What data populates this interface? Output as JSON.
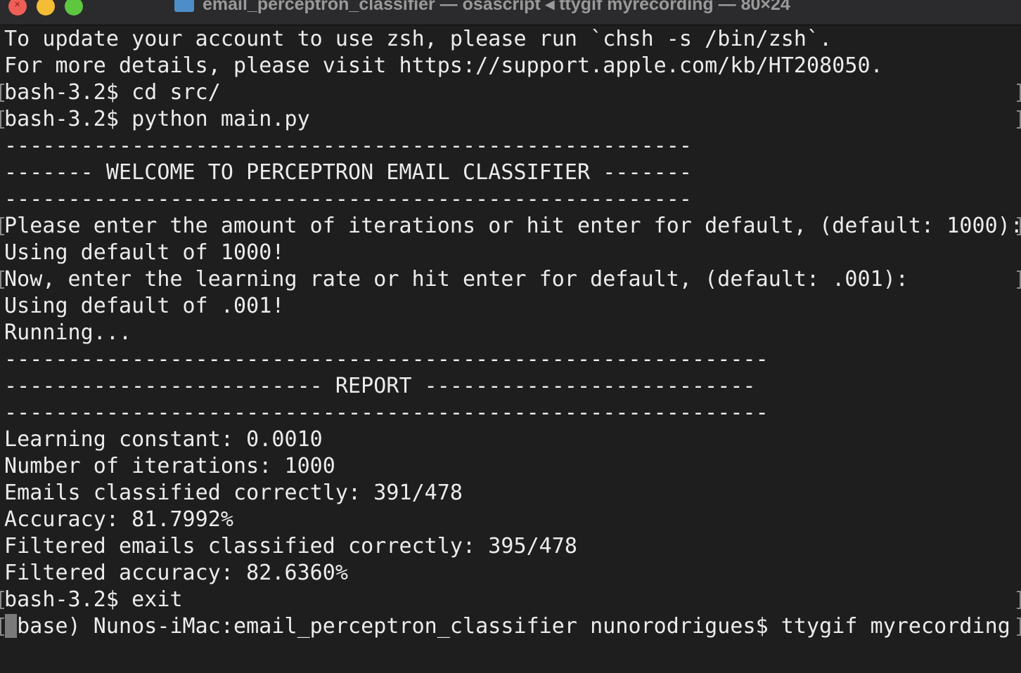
{
  "window": {
    "title": "email_perceptron_classifier — osascript ◂ ttygif myrecording — 80×24"
  },
  "colors": {
    "background": "#1e1e1e",
    "foreground": "#ececec",
    "titlebar": "#2b2b2d",
    "close": "#ee5f58",
    "minimize": "#f5bd34",
    "zoom": "#5ec63f"
  },
  "terminal": {
    "lines": [
      "To update your account to use zsh, please run `chsh -s /bin/zsh`.",
      "For more details, please visit https://support.apple.com/kb/HT208050.",
      "bash-3.2$ cd src/",
      "bash-3.2$ python main.py",
      "------------------------------------------------------",
      "------- WELCOME TO PERCEPTRON EMAIL CLASSIFIER -------",
      "------------------------------------------------------",
      "Please enter the amount of iterations or hit enter for default, (default: 1000):",
      "Using default of 1000!",
      "Now, enter the learning rate or hit enter for default, (default: .001):",
      "Using default of .001!",
      "Running...",
      "------------------------------------------------------------",
      "------------------------- REPORT --------------------------",
      "------------------------------------------------------------",
      "Learning constant: 0.0010",
      "Number of iterations: 1000",
      "Emails classified correctly: 391/478",
      "Accuracy: 81.7992%",
      "Filtered emails classified correctly: 395/478",
      "Filtered accuracy: 82.6360%",
      "bash-3.2$ exit",
      "(base) Nunos-iMac:email_perceptron_classifier nunorodrigues$ ttygif myrecording"
    ]
  }
}
